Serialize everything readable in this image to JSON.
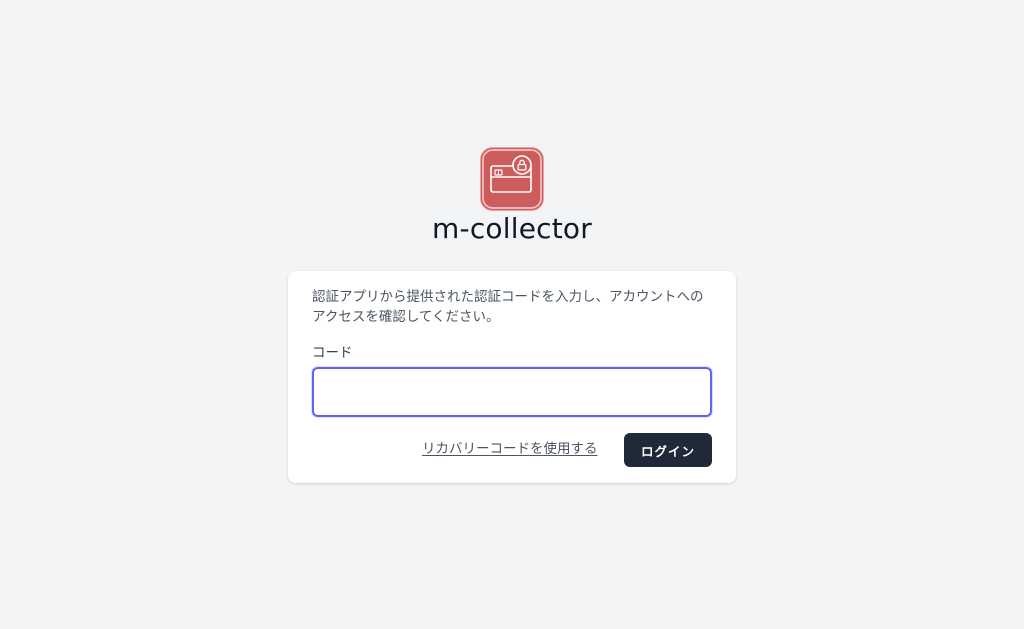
{
  "app": {
    "name": "m-collector",
    "logo_icon": "card-lock-icon",
    "logo_color": "#cd5c5c"
  },
  "two_factor": {
    "instructions": "認証アプリから提供された認証コードを入力し、アカウントへのアクセスを確認してください。",
    "code_label": "コード",
    "code_value": "",
    "recovery_link": "リカバリーコードを使用する",
    "login_button": "ログイン"
  },
  "colors": {
    "background": "#f3f4f6",
    "card": "#ffffff",
    "input_focus_border": "#6366f1",
    "button": "#1f2937",
    "button_text": "#ffffff"
  }
}
